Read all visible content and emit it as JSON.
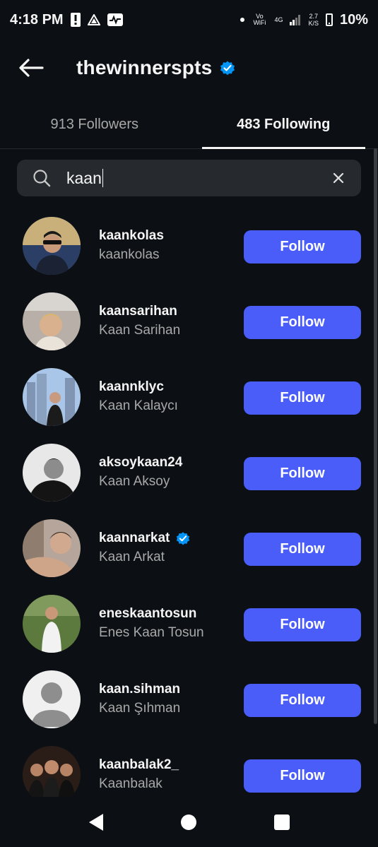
{
  "status_bar": {
    "time": "4:18 PM",
    "volte_label": "Vo WiFi",
    "network_label": "4G",
    "speed_value": "2.7",
    "speed_unit": "K/S",
    "battery": "10%"
  },
  "header": {
    "title": "thewinnerspts",
    "verified": true
  },
  "tabs": [
    {
      "label": "913 Followers",
      "active": false
    },
    {
      "label": "483 Following",
      "active": true
    }
  ],
  "search": {
    "value": "kaan"
  },
  "users": [
    {
      "username": "kaankolas",
      "full_name": "kaankolas",
      "verified": false,
      "button": "Follow",
      "avatar": "photo-sunglasses"
    },
    {
      "username": "kaansarihan",
      "full_name": "Kaan Sarihan",
      "verified": false,
      "button": "Follow",
      "avatar": "photo-child"
    },
    {
      "username": "kaannklyc",
      "full_name": "Kaan Kalaycı",
      "verified": false,
      "button": "Follow",
      "avatar": "photo-city"
    },
    {
      "username": "aksoykaan24",
      "full_name": "Kaan Aksoy",
      "verified": false,
      "button": "Follow",
      "avatar": "photo-bw"
    },
    {
      "username": "kaannarkat",
      "full_name": "Kaan Arkat",
      "verified": true,
      "button": "Follow",
      "avatar": "photo-portrait"
    },
    {
      "username": "eneskaantosun",
      "full_name": "Enes Kaan Tosun",
      "verified": false,
      "button": "Follow",
      "avatar": "photo-park"
    },
    {
      "username": "kaan.sihman",
      "full_name": "Kaan Şıhman",
      "verified": false,
      "button": "Follow",
      "avatar": "default-avatar"
    },
    {
      "username": "kaanbalak2_",
      "full_name": "Kaanbalak",
      "verified": false,
      "button": "Follow",
      "avatar": "photo-group"
    }
  ],
  "colors": {
    "background": "#0c1014",
    "follow_button": "#4a5df9",
    "verified_badge": "#0095f6",
    "secondary_text": "#a8a8a8"
  }
}
